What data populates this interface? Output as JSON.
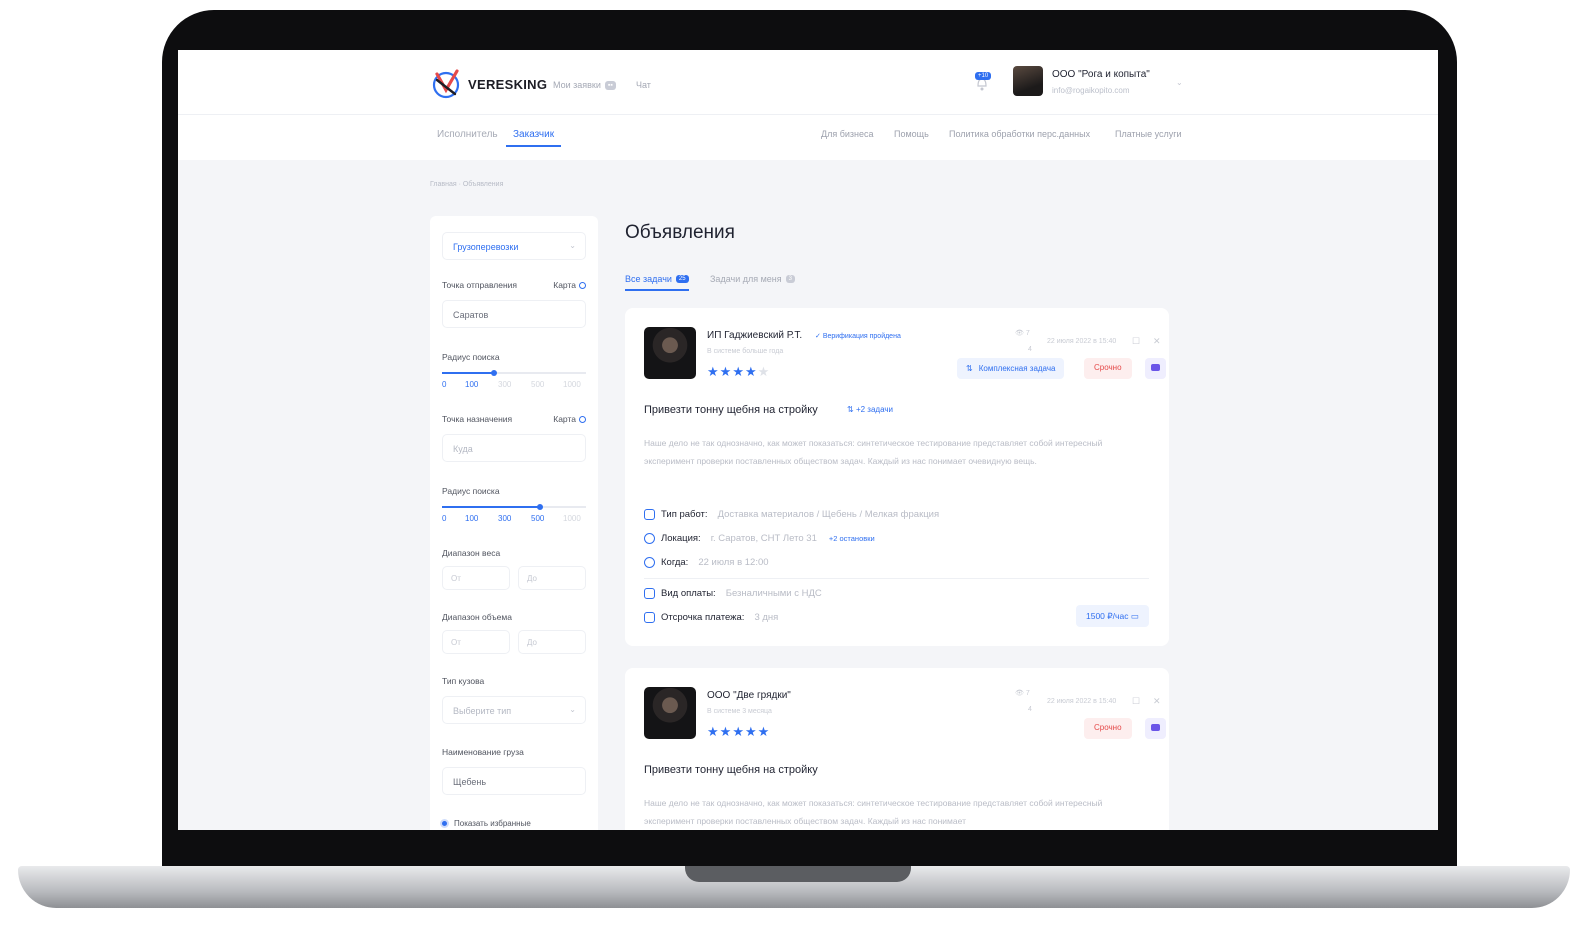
{
  "colors": {
    "accent": "#2f6ff0",
    "urgent": "#e54a4a",
    "text": "#1f2230",
    "muted": "#b9bcc6"
  },
  "header": {
    "logo_text": "VERESKING",
    "nav": [
      {
        "label": "Мои заявки"
      },
      {
        "label": "Чат"
      }
    ],
    "company_name": "ООО \"Рога и копыта\"",
    "company_email": "info@rogaikopito.com"
  },
  "subnav": {
    "roles": [
      "Исполнитель",
      "Заказчик"
    ],
    "links": [
      "Для бизнеса",
      "Помощь",
      "Политика обработки перс.данных",
      "Платные услуги"
    ]
  },
  "breadcrumb": "Главная · Объявления",
  "filters": {
    "category": "Грузоперевозки",
    "origin_label": "Точка отправления",
    "map_label": "Карта",
    "origin_value": "Саратов",
    "radius_label": "Радиус поиска",
    "radius_ticks_1": [
      "0",
      "100",
      "300",
      "500",
      "1000"
    ],
    "radius_level_1": 100,
    "destination_label": "Точка назначения",
    "destination_placeholder": "Куда",
    "radius_ticks_2": [
      "0",
      "100",
      "300",
      "500",
      "1000"
    ],
    "radius_level_2": 500,
    "weight_label": "Диапазон веса",
    "from_placeholder": "От",
    "to_placeholder": "До",
    "volume_label": "Диапазон объема",
    "body_type_label": "Тип кузова",
    "body_type_placeholder": "Выберите тип",
    "cargo_name_label": "Наименование груза",
    "cargo_name_value": "Щебень",
    "favorites_label": "Показать избранные"
  },
  "main": {
    "title": "Объявления",
    "tabs": [
      {
        "label": "Все задачи",
        "count": "25"
      },
      {
        "label": "Задачи для меня",
        "count": "3"
      }
    ],
    "listings": [
      {
        "name": "ИП Гаджиевский Р.Т.",
        "verified": "Верификация пройдена",
        "subtitle": "В системе больше года",
        "rating": 4,
        "views": "7",
        "replies": "4",
        "date": "22 июля 2022 в 15:40",
        "complex_badge": "Комплексная задача",
        "urgent_badge": "Срочно",
        "title": "Привезти тонну щебня на стройку",
        "extra_tasks": "+2 задачи",
        "description": "Наше дело не так однозначно, как может показаться: синтетическое тестирование представляет собой интересный эксперимент проверки поставленных обществом задач. Каждый из нас понимает очевидную вещь.",
        "details": [
          {
            "label": "Тип работ:",
            "value": "Доставка материалов / Щебень / Мелкая фракция"
          },
          {
            "label": "Локация:",
            "value": "г. Саратов, СНТ Лето 31",
            "link": "+2 остановки"
          },
          {
            "label": "Когда:",
            "value": "22 июля в 12:00"
          },
          {
            "label": "Вид оплаты:",
            "value": "Безналичными с НДС"
          },
          {
            "label": "Отсрочка платежа:",
            "value": "3 дня"
          }
        ],
        "price": "1500 ₽/час"
      },
      {
        "name": "ООО \"Две грядки\"",
        "subtitle": "В системе 3 месяца",
        "rating": 5,
        "views": "7",
        "replies": "4",
        "date": "22 июля 2022 в 15:40",
        "urgent_badge": "Срочно",
        "title": "Привезти тонну щебня на стройку",
        "description": "Наше дело не так однозначно, как может показаться: синтетическое тестирование представляет собой интересный эксперимент проверки поставленных обществом задач. Каждый из нас понимает"
      }
    ]
  }
}
